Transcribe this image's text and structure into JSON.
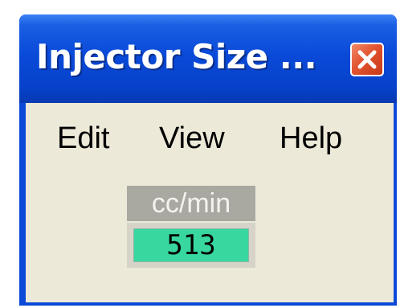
{
  "window": {
    "title": "Injector Size ...",
    "close_icon": "close-icon"
  },
  "menu": {
    "items": [
      "Edit",
      "View",
      "Help"
    ]
  },
  "readout": {
    "unit": "cc/min",
    "value": "513"
  },
  "colors": {
    "titlebar": "#0a4ad9",
    "close_button": "#e2532f",
    "window_body": "#ece9d8",
    "unit_label_bg": "#a9a9a1",
    "value_field_bg": "#38d7a0"
  }
}
